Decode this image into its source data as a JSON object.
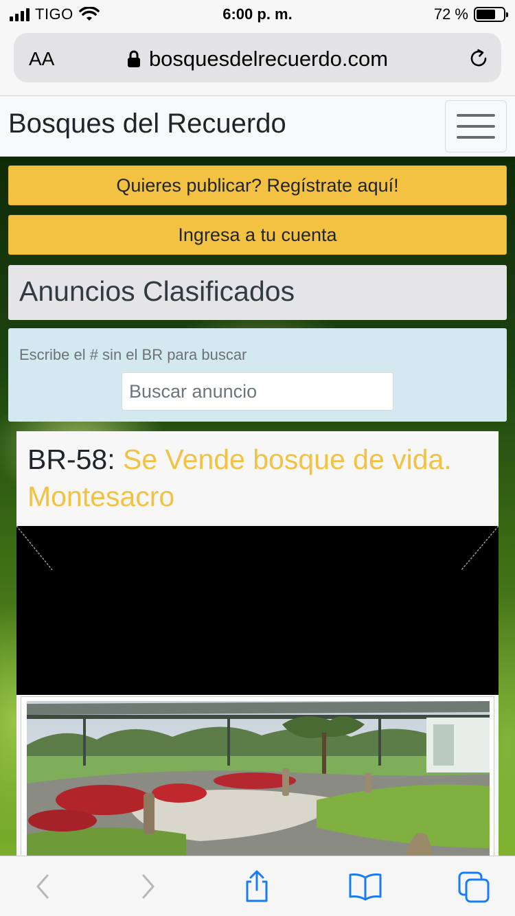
{
  "status_bar": {
    "carrier": "TIGO",
    "time": "6:00 p. m.",
    "battery": "72 %",
    "battery_level": 0.72
  },
  "browser": {
    "text_size_label": "AA",
    "url": "bosquesdelrecuerdo.com"
  },
  "navbar": {
    "brand": "Bosques del Recuerdo"
  },
  "actions": {
    "register": "Quieres publicar? Regístrate aquí!",
    "login": "Ingresa a tu cuenta"
  },
  "section": {
    "title": "Anuncios Clasificados"
  },
  "search": {
    "hint": "Escribe el # sin el BR para buscar",
    "placeholder": "Buscar anuncio"
  },
  "listing": {
    "code": "BR-58:",
    "title": "Se Vende bosque de vida. Montesacro"
  },
  "colors": {
    "accent_yellow": "#f4c243",
    "search_bg": "#d4e9ef",
    "ios_blue": "#1a7cf5"
  }
}
